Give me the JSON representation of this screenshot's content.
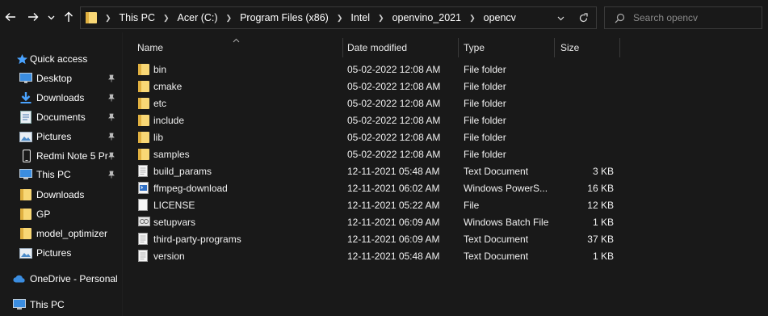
{
  "nav": {
    "back": "back-arrow",
    "forward": "forward-arrow",
    "recent": "chevron-down",
    "up": "up-arrow"
  },
  "address": {
    "crumbs": [
      "This PC",
      "Acer (C:)",
      "Program Files (x86)",
      "Intel",
      "openvino_2021",
      "opencv"
    ]
  },
  "search": {
    "placeholder": "Search opencv"
  },
  "sidebar": {
    "quick_access": "Quick access",
    "items": [
      {
        "label": "Desktop",
        "pinned": true,
        "icon": "desktop-icon"
      },
      {
        "label": "Downloads",
        "pinned": true,
        "icon": "download-icon"
      },
      {
        "label": "Documents",
        "pinned": true,
        "icon": "documents-icon"
      },
      {
        "label": "Pictures",
        "pinned": true,
        "icon": "pictures-icon"
      },
      {
        "label": "Redmi Note 5 Pr",
        "pinned": true,
        "icon": "phone-icon"
      },
      {
        "label": "This PC",
        "pinned": true,
        "icon": "pc-icon"
      },
      {
        "label": "Downloads",
        "pinned": false,
        "icon": "folder-icon"
      },
      {
        "label": "GP",
        "pinned": false,
        "icon": "folder-icon"
      },
      {
        "label": "model_optimizer",
        "pinned": false,
        "icon": "folder-icon"
      },
      {
        "label": "Pictures",
        "pinned": false,
        "icon": "pictures-icon"
      }
    ],
    "onedrive": "OneDrive - Personal",
    "this_pc": "This PC"
  },
  "columns": {
    "name": "Name",
    "date": "Date modified",
    "type": "Type",
    "size": "Size"
  },
  "files": [
    {
      "name": "bin",
      "date": "05-02-2022 12:08 AM",
      "type": "File folder",
      "size": "",
      "icon": "folder"
    },
    {
      "name": "cmake",
      "date": "05-02-2022 12:08 AM",
      "type": "File folder",
      "size": "",
      "icon": "folder"
    },
    {
      "name": "etc",
      "date": "05-02-2022 12:08 AM",
      "type": "File folder",
      "size": "",
      "icon": "folder"
    },
    {
      "name": "include",
      "date": "05-02-2022 12:08 AM",
      "type": "File folder",
      "size": "",
      "icon": "folder"
    },
    {
      "name": "lib",
      "date": "05-02-2022 12:08 AM",
      "type": "File folder",
      "size": "",
      "icon": "folder"
    },
    {
      "name": "samples",
      "date": "05-02-2022 12:08 AM",
      "type": "File folder",
      "size": "",
      "icon": "folder"
    },
    {
      "name": "build_params",
      "date": "12-11-2021 05:48 AM",
      "type": "Text Document",
      "size": "3 KB",
      "icon": "text"
    },
    {
      "name": "ffmpeg-download",
      "date": "12-11-2021 06:02 AM",
      "type": "Windows PowerS...",
      "size": "16 KB",
      "icon": "powershell"
    },
    {
      "name": "LICENSE",
      "date": "12-11-2021 05:22 AM",
      "type": "File",
      "size": "12 KB",
      "icon": "file"
    },
    {
      "name": "setupvars",
      "date": "12-11-2021 06:09 AM",
      "type": "Windows Batch File",
      "size": "1 KB",
      "icon": "batch"
    },
    {
      "name": "third-party-programs",
      "date": "12-11-2021 06:09 AM",
      "type": "Text Document",
      "size": "37 KB",
      "icon": "text"
    },
    {
      "name": "version",
      "date": "12-11-2021 05:48 AM",
      "type": "Text Document",
      "size": "1 KB",
      "icon": "text"
    }
  ],
  "colors": {
    "folder": "#f8d775",
    "folder_dark": "#e0b040",
    "accent": "#4aa3ff",
    "text": "#ffffff",
    "bg": "#191919"
  }
}
